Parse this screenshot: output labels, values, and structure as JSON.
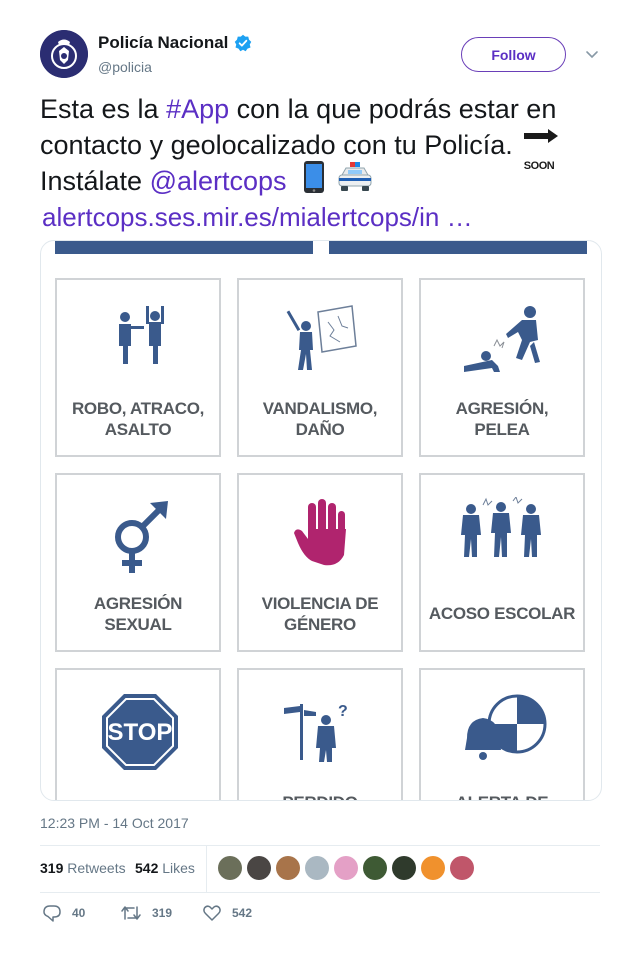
{
  "account": {
    "name": "Policía Nacional",
    "handle": "@policia",
    "verified": true,
    "follow_label": "Follow",
    "accent_color": "#5b2fc4"
  },
  "tweet": {
    "line1_pre": "Esta es la ",
    "line1_hashtag": "#App",
    "line1_post": " con la que podrás estar en",
    "line2": "contacto y geolocalizado con tu Policía.",
    "line2_emoji": "soon-arrow-icon",
    "line3_pre": "Instálate ",
    "line3_mention": "@alertcops",
    "line3_emojis": [
      "mobile-phone-icon",
      "police-car-icon"
    ],
    "line4_link": "alertcops.ses.mir.es/mialertcops/in …",
    "soon_text": "SOON"
  },
  "media": {
    "tiles": [
      {
        "label_lines": [
          "ROBO, ATRACO,",
          "ASALTO"
        ],
        "icon": "robbery-icon"
      },
      {
        "label_lines": [
          "VANDALISMO,",
          "DAÑO"
        ],
        "icon": "vandalism-icon"
      },
      {
        "label_lines": [
          "AGRESIÓN,",
          "PELEA"
        ],
        "icon": "fight-icon"
      },
      {
        "label_lines": [
          "AGRESIÓN",
          "SEXUAL"
        ],
        "icon": "gender-symbol-icon"
      },
      {
        "label_lines": [
          "VIOLENCIA DE",
          "GÉNERO"
        ],
        "icon": "red-hand-icon"
      },
      {
        "label_lines": [
          "ACOSO ESCOLAR"
        ],
        "icon": "bullying-icon"
      },
      {
        "label_lines": [],
        "icon": "stop-sign-icon",
        "sign_text": "STOP"
      },
      {
        "label_lines": [
          "PERDIDO"
        ],
        "icon": "lost-person-icon"
      },
      {
        "label_lines": [
          "ALERTA DE"
        ],
        "icon": "alert-bell-icon"
      }
    ],
    "colors": {
      "icon_blue": "#3a5a8c",
      "hand_magenta": "#b0246e",
      "label_gray": "#555a5f"
    }
  },
  "meta": {
    "timestamp": "12:23 PM - 14 Oct 2017",
    "retweets_count": "319",
    "retweets_label": "Retweets",
    "likes_count": "542",
    "likes_label": "Likes"
  },
  "actions": {
    "reply_count": "40",
    "retweet_count": "319",
    "like_count": "542"
  }
}
